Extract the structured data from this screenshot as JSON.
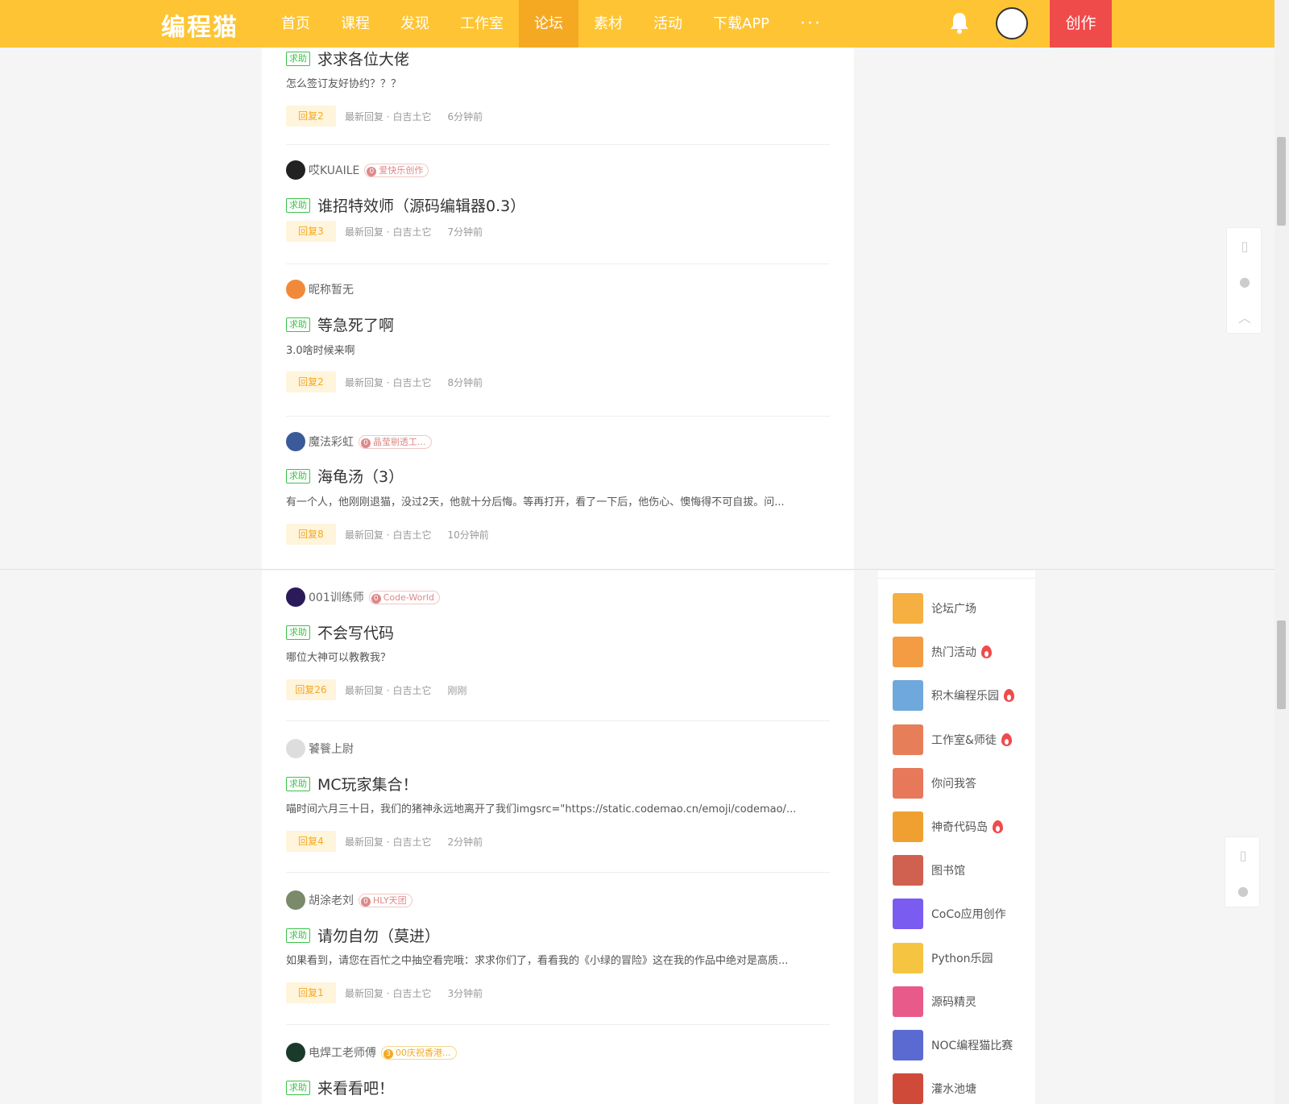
{
  "colors": {
    "accent": "#fec433",
    "active_nav": "#f5a822",
    "create": "#ef4b4b",
    "tag_green": "#3cc34a"
  },
  "header": {
    "logo": "编程猫",
    "nav": [
      "首页",
      "课程",
      "发现",
      "工作室",
      "论坛",
      "素材",
      "活动",
      "下载APP"
    ],
    "more": "···",
    "create": "创作"
  },
  "tag_label": "求助",
  "posts_top": [
    {
      "title": "求求各位大佬",
      "excerpt": "怎么签订友好协约？？？",
      "reply": "回复2",
      "latest": "最新回复 · 白吉土它",
      "time": "6分钟前"
    },
    {
      "author": "哎KUAILE",
      "badge": "爱快乐创作",
      "badge_num": "0",
      "title": "谁招特效师（源码编辑器0.3）",
      "reply": "回复3",
      "latest": "最新回复 · 白吉土它",
      "time": "7分钟前"
    },
    {
      "author": "昵称暂无",
      "title": "等急死了啊",
      "excerpt": "3.0啥时候来啊",
      "reply": "回复2",
      "latest": "最新回复 · 白吉土它",
      "time": "8分钟前"
    },
    {
      "author": "魔法彩虹",
      "badge": "晶莹剔透工...",
      "badge_num": "0",
      "title": "海龟汤（3）",
      "excerpt": "有一个人，他刚刚退猫，没过2天，他就十分后悔。等再打开，看了一下后，他伤心、懊悔得不可自拔。问...",
      "reply": "回复8",
      "latest": "最新回复 · 白吉土它",
      "time": "10分钟前"
    }
  ],
  "posts_bottom": [
    {
      "author": "001训练师",
      "badge": "Code-World",
      "badge_num": "0",
      "title": "不会写代码",
      "excerpt": "哪位大神可以教教我？",
      "reply": "回复26",
      "latest": "最新回复 · 白吉土它",
      "time": "刚刚"
    },
    {
      "author": "饕餮上尉",
      "title": "MC玩家集合！",
      "excerpt": "喵时间六月三十日，我们的猪神永远地离开了我们imgsrc=\"https://static.codemao.cn/emoji/codemao/...",
      "reply": "回复4",
      "latest": "最新回复 · 白吉土它",
      "time": "2分钟前"
    },
    {
      "author": "胡涂老刘",
      "badge": "HLY天团",
      "badge_num": "0",
      "title": "请勿自勿（莫进）",
      "excerpt": "如果看到，请您在百忙之中抽空看完哦：求求你们了，看看我的《小绿的冒险》这在我的作品中绝对是高质...",
      "reply": "回复1",
      "latest": "最新回复 · 白吉土它",
      "time": "3分钟前"
    },
    {
      "author": "电焊工老师傅",
      "badge": "00庆祝香港...",
      "badge_num": "3",
      "title": "来看看吧！"
    }
  ],
  "sidebar": {
    "items": [
      {
        "label": "论坛广场",
        "hot": false,
        "color": "#f5b041"
      },
      {
        "label": "热门活动",
        "hot": true,
        "color": "#f39c44"
      },
      {
        "label": "积木编程乐园",
        "hot": true,
        "color": "#6fa8dc"
      },
      {
        "label": "工作室&师徒",
        "hot": true,
        "color": "#e67e5a"
      },
      {
        "label": "你问我答",
        "hot": false,
        "color": "#e8785a"
      },
      {
        "label": "神奇代码岛",
        "hot": true,
        "color": "#f0a030"
      },
      {
        "label": "图书馆",
        "hot": false,
        "color": "#d06050"
      },
      {
        "label": "CoCo应用创作",
        "hot": false,
        "color": "#7a5cf0"
      },
      {
        "label": "Python乐园",
        "hot": false,
        "color": "#f5c542"
      },
      {
        "label": "源码精灵",
        "hot": false,
        "color": "#e85a8a"
      },
      {
        "label": "NOC编程猫比赛",
        "hot": false,
        "color": "#5a6ad0"
      },
      {
        "label": "灌水池塘",
        "hot": false,
        "color": "#d04a3a"
      }
    ]
  }
}
